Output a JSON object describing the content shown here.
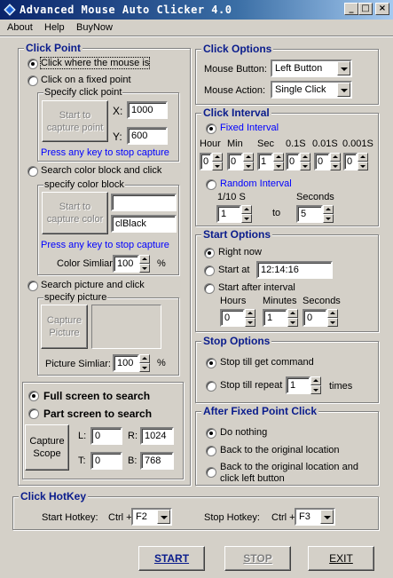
{
  "window": {
    "title": "Advanced Mouse Auto Clicker 4.0",
    "min": "_",
    "max": "□",
    "close": "×"
  },
  "menu": {
    "about": "About",
    "help": "Help",
    "buynow": "BuyNow"
  },
  "click_point": {
    "title": "Click Point",
    "opt_mouse": "Click where the mouse is",
    "opt_fixed": "Click on a fixed point",
    "specify_point": "Specify click point",
    "capture_point_btn": "Start to capture point",
    "x_label": "X:",
    "x_value": "1000",
    "y_label": "Y:",
    "y_value": "600",
    "hint1": "Press any key to stop capture",
    "opt_color": "Search color block and click",
    "specify_color": "specify color block",
    "capture_color_btn": "Start to capture color",
    "color_value": "",
    "color_name": "clBlack",
    "hint2": "Press any key to stop capture",
    "color_similar_label": "Color Simliar:",
    "color_similar_value": "100",
    "percent": "%",
    "opt_picture": "Search picture and click",
    "specify_picture": "specify picture",
    "capture_picture_btn": "Capture Picture",
    "picture_similar_label": "Picture Simliar:",
    "picture_similar_value": "100",
    "percent2": "%"
  },
  "scope": {
    "full": "Full screen to search",
    "part": "Part screen to search",
    "capture_btn": "Capture Scope",
    "l_label": "L:",
    "l_value": "0",
    "r_label": "R:",
    "r_value": "1024",
    "t_label": "T:",
    "t_value": "0",
    "b_label": "B:",
    "b_value": "768"
  },
  "click_options": {
    "title": "Click Options",
    "mouse_button_label": "Mouse Button:",
    "mouse_button_value": "Left Button",
    "mouse_action_label": "Mouse Action:",
    "mouse_action_value": "Single Click"
  },
  "click_interval": {
    "title": "Click Interval",
    "fixed": "Fixed Interval",
    "hour": "Hour",
    "min": "Min",
    "sec": "Sec",
    "s01": "0.1S",
    "s001": "0.01S",
    "s0001": "0.001S",
    "v_hour": "0",
    "v_min": "0",
    "v_sec": "1",
    "v_01": "0",
    "v_001": "0",
    "v_0001": "0",
    "random": "Random Interval",
    "tenth_label": "1/10 S",
    "seconds_label": "Seconds",
    "rand_from": "1",
    "to_label": "to",
    "rand_to": "5"
  },
  "start_options": {
    "title": "Start Options",
    "right_now": "Right now",
    "start_at": "Start at",
    "start_at_value": "12:14:16",
    "after_interval": "Start after interval",
    "hours": "Hours",
    "minutes": "Minutes",
    "seconds": "Seconds",
    "v_hours": "0",
    "v_minutes": "1",
    "v_seconds": "0"
  },
  "stop_options": {
    "title": "Stop Options",
    "till_command": "Stop till get command",
    "till_repeat": "Stop till repeat",
    "repeat_value": "1",
    "times": "times"
  },
  "after_fixed": {
    "title": "After Fixed Point Click",
    "nothing": "Do nothing",
    "back": "Back to the original location",
    "back_click": "Back to the original location and click left button"
  },
  "hotkey": {
    "title": "Click HotKey",
    "start_label": "Start Hotkey:",
    "start_mod": "Ctrl +",
    "start_key": "F2",
    "stop_label": "Stop Hotkey:",
    "stop_mod": "Ctrl +",
    "stop_key": "F3"
  },
  "buttons": {
    "start": "START",
    "stop": "STOP",
    "exit": "EXIT"
  }
}
